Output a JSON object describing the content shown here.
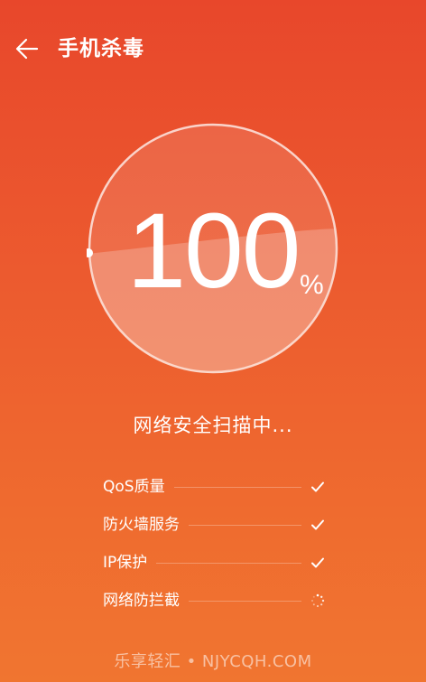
{
  "header": {
    "title": "手机杀毒",
    "back_icon": "arrow-left-icon"
  },
  "scan": {
    "progress_value": "100",
    "progress_unit": "%",
    "progress_fraction": 1.0,
    "status_text": "网络安全扫描中..."
  },
  "checklist": [
    {
      "label": "QoS质量",
      "state": "done",
      "icon": "check-icon"
    },
    {
      "label": "防火墙服务",
      "state": "done",
      "icon": "check-icon"
    },
    {
      "label": "IP保护",
      "state": "done",
      "icon": "check-icon"
    },
    {
      "label": "网络防拦截",
      "state": "in-progress",
      "icon": "spinner-icon"
    }
  ],
  "watermark": "乐享轻汇 • NJYCQH.COM",
  "colors": {
    "bg_top": "#e8472b",
    "bg_bottom": "#f07530",
    "text": "#ffffff"
  }
}
